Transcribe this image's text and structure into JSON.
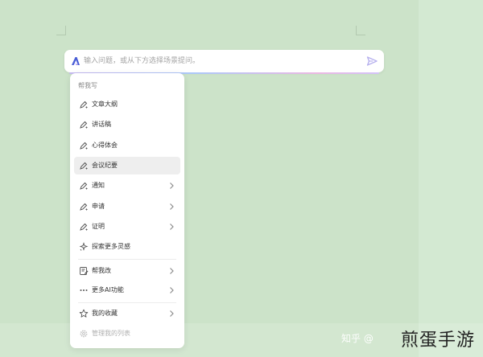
{
  "ai_bar": {
    "placeholder": "输入问题，或从下方选择场景提问。",
    "logo_icon": "ai-logo-icon",
    "send_icon": "paper-plane-icon"
  },
  "menu": {
    "heading": "帮我写",
    "items": [
      {
        "label": "文章大纲",
        "icon": "pen-sparkle-icon"
      },
      {
        "label": "讲话稿",
        "icon": "pen-sparkle-icon"
      },
      {
        "label": "心得体会",
        "icon": "pen-sparkle-icon"
      },
      {
        "label": "会议纪要",
        "icon": "pen-sparkle-icon",
        "active": true
      },
      {
        "label": "通知",
        "icon": "pen-sparkle-icon",
        "submenu": true
      },
      {
        "label": "申请",
        "icon": "pen-sparkle-icon",
        "submenu": true
      },
      {
        "label": "证明",
        "icon": "pen-sparkle-icon",
        "submenu": true
      },
      {
        "label": "探索更多灵感",
        "icon": "sparkle-explore-icon"
      }
    ],
    "group2": [
      {
        "label": "帮我改",
        "icon": "edit-document-icon",
        "submenu": true
      },
      {
        "label": "更多AI功能",
        "icon": "more-dots-icon",
        "submenu": true
      }
    ],
    "group3": [
      {
        "label": "我的收藏",
        "icon": "star-icon",
        "submenu": true
      }
    ],
    "footer": {
      "label": "管理我的列表",
      "icon": "gear-icon"
    }
  },
  "watermark": {
    "source": "知乎 @",
    "site": "煎蛋手游"
  },
  "colors": {
    "background": "#cce3c9",
    "accent": "#a99cf0"
  }
}
